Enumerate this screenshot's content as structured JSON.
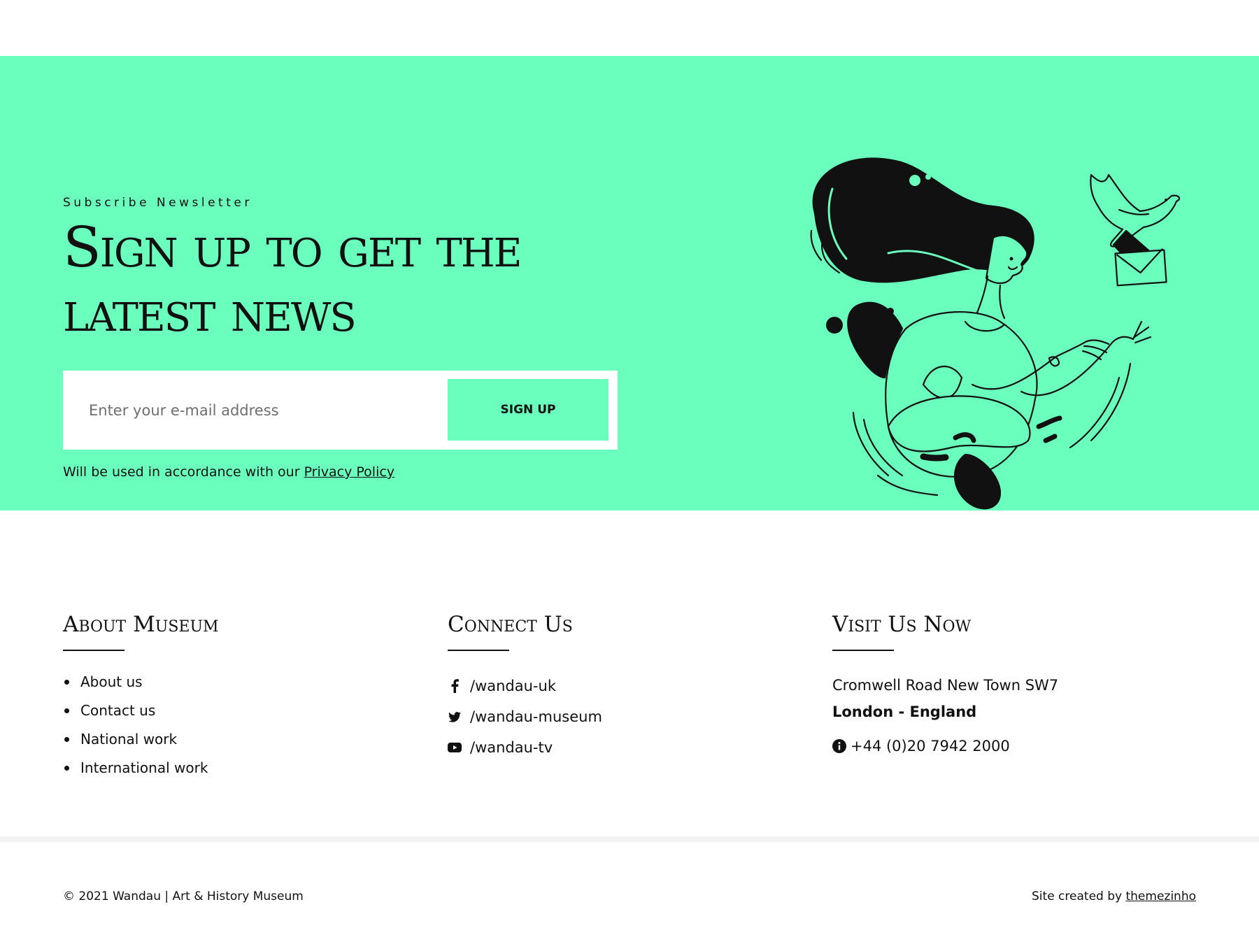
{
  "newsletter": {
    "eyebrow": "Subscribe Newsletter",
    "headline_line1": "Sign up to get the",
    "headline_line2": "latest news",
    "email_placeholder": "Enter your e-mail address",
    "email_value": "",
    "button_label": "SIGN UP",
    "privacy_prefix": "Will be used in accordance with our ",
    "privacy_link": "Privacy Policy",
    "background_color": "#6bffbe"
  },
  "footer": {
    "about": {
      "title": "About Museum",
      "items": [
        "About us",
        "Contact us",
        "National work",
        "International work"
      ]
    },
    "connect": {
      "title": "Connect Us",
      "items": [
        {
          "icon": "facebook-icon",
          "label": "/wandau-uk"
        },
        {
          "icon": "twitter-icon",
          "label": "/wandau-museum"
        },
        {
          "icon": "youtube-icon",
          "label": "/wandau-tv"
        }
      ]
    },
    "visit": {
      "title": "Visit Us Now",
      "address_line1": "Cromwell Road New Town SW7",
      "address_line2": "London - England",
      "phone_icon": "info-icon",
      "phone": "+44 (0)20 7942 2000"
    }
  },
  "bottom": {
    "copyright": "© 2021 Wandau | Art & History Museum",
    "credit_prefix": "Site created by ",
    "credit_link": "themezinho"
  }
}
